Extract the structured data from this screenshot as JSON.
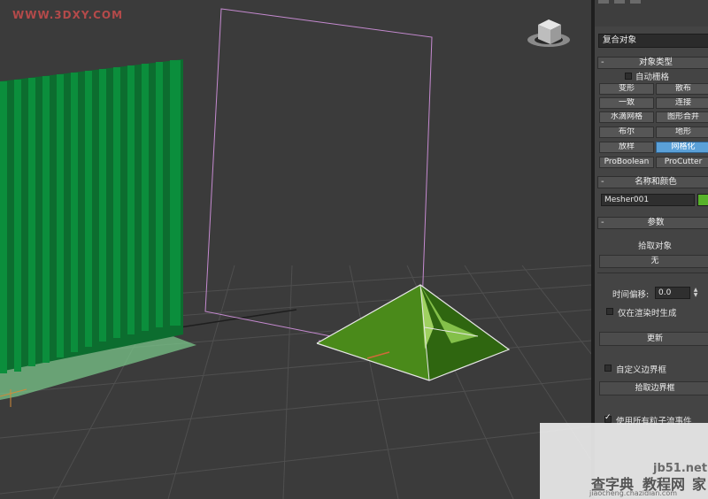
{
  "watermark_top": "WWW.3DXY.COM",
  "watermark_bottom": {
    "site1": "jb51.net",
    "site1_cn": "查字典",
    "site2": "教程网",
    "site2_tail": "家",
    "url": "jiaocheng.chazidian.com"
  },
  "panel": {
    "category_dropdown": "复合对象",
    "object_type": {
      "title": "对象类型",
      "autogrid_label": "自动栅格",
      "autogrid_checked": false,
      "buttons": [
        {
          "label": "变形",
          "active": false
        },
        {
          "label": "散布",
          "active": false
        },
        {
          "label": "一致",
          "active": false
        },
        {
          "label": "连接",
          "active": false
        },
        {
          "label": "水滴网格",
          "active": false
        },
        {
          "label": "图形合并",
          "active": false
        },
        {
          "label": "布尔",
          "active": false
        },
        {
          "label": "地形",
          "active": false
        },
        {
          "label": "放样",
          "active": false
        },
        {
          "label": "网格化",
          "active": true
        },
        {
          "label": "ProBoolean",
          "active": false
        },
        {
          "label": "ProCutter",
          "active": false
        }
      ]
    },
    "name_color": {
      "title": "名称和颜色",
      "name_value": "Mesher001",
      "color": "#58b22a"
    },
    "params": {
      "title": "参数",
      "pick_object_label": "拾取对象",
      "pick_object_value": "无",
      "time_offset_label": "时间偏移:",
      "time_offset_value": "0.0",
      "render_only_label": "仅在渲染时生成",
      "render_only_checked": false,
      "update_button": "更新",
      "custom_bbox_label": "自定义边界框",
      "custom_bbox_checked": false,
      "pick_bbox_button": "拾取边界框",
      "use_all_events_label": "使用所有粒子流事件",
      "use_all_events_checked": true
    }
  },
  "colors": {
    "viewport_bg": "#3b3b3b",
    "grid": "#4d4d4d",
    "green_object": "#0f7a35",
    "mesh_green": "#4a8a1a",
    "selection_purple": "#c58ad0",
    "active_button": "#5aa0d8"
  }
}
